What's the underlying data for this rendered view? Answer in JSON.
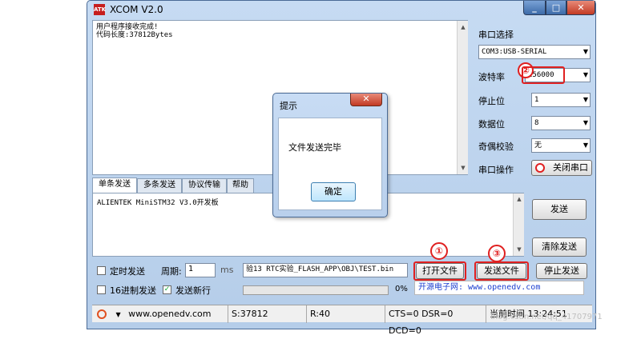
{
  "window": {
    "title": "XCOM V2.0",
    "logo_text": "ATK",
    "min": "_",
    "max": "□",
    "close": "✕"
  },
  "receive": {
    "lines": [
      "用户程序接收完成!",
      "代码长度:37812Bytes"
    ]
  },
  "panel": {
    "port_label": "串口选择",
    "port_value": "COM3:USB-SERIAL",
    "baud_label": "波特率",
    "baud_value": "256000",
    "stop_label": "停止位",
    "stop_value": "1",
    "data_label": "数据位",
    "data_value": "8",
    "parity_label": "奇偶校验",
    "parity_value": "无",
    "op_label": "串口操作",
    "op_button": "关闭串口"
  },
  "tabs": [
    "单条发送",
    "多条发送",
    "协议传输",
    "帮助"
  ],
  "send": {
    "text": "ALIENTEK MiniSTM32 V3.0开发板",
    "send_button": "发送",
    "clear_button": "清除发送"
  },
  "bottom": {
    "timed_send": "定时发送",
    "period_label": "周期:",
    "period_value": "1",
    "period_unit": "ms",
    "file_path": "验13 RTC实验_FLASH_APP\\OBJ\\TEST.bin",
    "open_file": "打开文件",
    "send_file": "发送文件",
    "stop_send": "停止发送",
    "hex_send": "16进制发送",
    "newline_send": "发送新行",
    "newline_checked": "✓",
    "progress_text": "0%",
    "progress": 0,
    "url_text": "开源电子网: www.openedv.com"
  },
  "status": {
    "url": "www.openedv.com",
    "s": "S:37812",
    "r": "R:40",
    "signals": "CTS=0 DSR=0 DCD=0",
    "time": "当前时间 13:24:51"
  },
  "annotations": {
    "n1": "①",
    "n2": "②",
    "n3": "③"
  },
  "dialog": {
    "title": "提示",
    "close": "✕",
    "message": "文件发送完毕",
    "ok": "确定"
  },
  "watermark": "blog.csdn.net/qq_41707971",
  "colors": {
    "annotation": "#e02020",
    "url_text": "#1c3fd0"
  }
}
